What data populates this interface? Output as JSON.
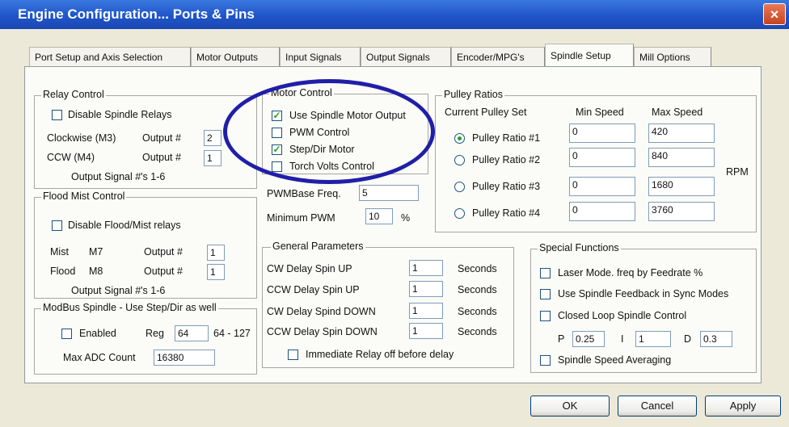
{
  "window": {
    "title": "Engine Configuration... Ports & Pins",
    "close_glyph": "×"
  },
  "tabs": [
    "Port Setup and Axis Selection",
    "Motor Outputs",
    "Input Signals",
    "Output Signals",
    "Encoder/MPG's",
    "Spindle Setup",
    "Mill Options"
  ],
  "active_tab": "Spindle Setup",
  "relay": {
    "title": "Relay Control",
    "disable_label": "Disable Spindle Relays",
    "disable_checked": false,
    "cw_label": "Clockwise (M3)",
    "output_label": "Output #",
    "cw_value": "2",
    "ccw_label": "CCW (M4)",
    "ccw_value": "1",
    "note": "Output Signal #'s 1-6"
  },
  "flood": {
    "title": "Flood Mist Control",
    "disable_label": "Disable Flood/Mist relays",
    "disable_checked": false,
    "mist_label": "Mist",
    "mist_code": "M7",
    "output_label": "Output #",
    "mist_value": "1",
    "flood_label": "Flood",
    "flood_code": "M8",
    "flood_value": "1",
    "note": "Output Signal #'s 1-6"
  },
  "modbus": {
    "title": "ModBus Spindle - Use Step/Dir as well",
    "enabled_label": "Enabled",
    "enabled_checked": false,
    "reg_label": "Reg",
    "reg_value": "64",
    "reg_range": "64 - 127",
    "adc_label": "Max ADC Count",
    "adc_value": "16380"
  },
  "motor": {
    "title": "Motor Control",
    "options": [
      {
        "label": "Use Spindle Motor Output",
        "checked": true
      },
      {
        "label": "PWM Control",
        "checked": false
      },
      {
        "label": "Step/Dir Motor",
        "checked": true
      },
      {
        "label": "Torch Volts Control",
        "checked": false
      }
    ],
    "pwm_base_label": "PWMBase Freq.",
    "pwm_base_value": "5",
    "min_pwm_label": "Minimum PWM",
    "min_pwm_value": "10",
    "min_pwm_unit": "%"
  },
  "pulley": {
    "title": "Pulley Ratios",
    "current_label": "Current Pulley Set",
    "min_header": "Min Speed",
    "max_header": "Max Speed",
    "rpm_label": "RPM",
    "rows": [
      {
        "label": "Pulley Ratio #1",
        "selected": true,
        "min": "0",
        "max": "420"
      },
      {
        "label": "Pulley Ratio #2",
        "selected": false,
        "min": "0",
        "max": "840"
      },
      {
        "label": "Pulley Ratio #3",
        "selected": false,
        "min": "0",
        "max": "1680"
      },
      {
        "label": "Pulley Ratio #4",
        "selected": false,
        "min": "0",
        "max": "3760"
      }
    ]
  },
  "general": {
    "title": "General Parameters",
    "rows": [
      {
        "label": "CW Delay Spin UP",
        "value": "1",
        "unit": "Seconds"
      },
      {
        "label": "CCW Delay Spin UP",
        "value": "1",
        "unit": "Seconds"
      },
      {
        "label": "CW Delay Spind DOWN",
        "value": "1",
        "unit": "Seconds"
      },
      {
        "label": "CCW Delay Spin DOWN",
        "value": "1",
        "unit": "Seconds"
      }
    ],
    "immediate_label": "Immediate Relay off before delay",
    "immediate_checked": false
  },
  "special": {
    "title": "Special Functions",
    "laser_label": "Laser Mode. freq by Feedrate %",
    "feedback_label": "Use Spindle Feedback in Sync Modes",
    "closed_label": "Closed Loop Spindle Control",
    "p_label": "P",
    "p_value": "0.25",
    "i_label": "I",
    "i_value": "1",
    "d_label": "D",
    "d_value": "0.3",
    "averaging_label": "Spindle Speed Averaging"
  },
  "buttons": {
    "ok": "OK",
    "cancel": "Cancel",
    "apply": "Apply"
  },
  "colors": {
    "title_bar": "#1f55c8",
    "highlight_ellipse": "#1f1fa8",
    "check_mark": "#21a121"
  }
}
